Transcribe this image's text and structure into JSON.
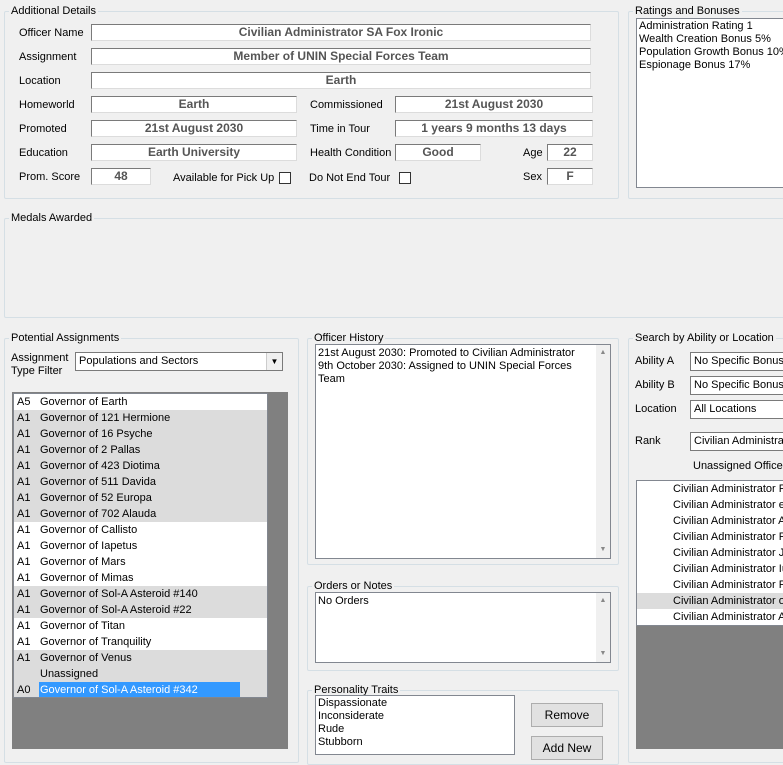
{
  "additional": {
    "legend": "Additional Details",
    "officer_name_label": "Officer Name",
    "officer_name": "Civilian Administrator SA Fox Ironic",
    "assignment_label": "Assignment",
    "assignment": "Member of UNIN Special Forces Team",
    "location_label": "Location",
    "location": "Earth",
    "homeworld_label": "Homeworld",
    "homeworld": "Earth",
    "commissioned_label": "Commissioned",
    "commissioned": "21st August 2030",
    "promoted_label": "Promoted",
    "promoted": "21st August 2030",
    "time_in_tour_label": "Time in Tour",
    "time_in_tour": "1 years 9 months 13 days",
    "education_label": "Education",
    "education": "Earth University",
    "health_label": "Health Condition",
    "health": "Good",
    "age_label": "Age",
    "age": "22",
    "prom_score_label": "Prom. Score",
    "prom_score": "48",
    "pickup_label": "Available for Pick Up",
    "not_end_tour_label": "Do Not End Tour",
    "sex_label": "Sex",
    "sex": "F"
  },
  "ratings": {
    "legend": "Ratings and Bonuses",
    "lines": [
      "Administration Rating 1",
      "Wealth Creation Bonus 5%",
      "Population Growth Bonus 10%",
      "Espionage Bonus 17%"
    ]
  },
  "medals": {
    "legend": "Medals Awarded"
  },
  "potential": {
    "legend": "Potential Assignments",
    "filter_label_1": "Assignment",
    "filter_label_2": "Type Filter",
    "filter_value": "Populations and Sectors",
    "items": [
      {
        "code": "A5",
        "name": "Governor of Earth",
        "shade": false
      },
      {
        "code": "A1",
        "name": "Governor of 121 Hermione",
        "shade": true
      },
      {
        "code": "A1",
        "name": "Governor of 16 Psyche",
        "shade": true
      },
      {
        "code": "A1",
        "name": "Governor of 2 Pallas",
        "shade": true
      },
      {
        "code": "A1",
        "name": "Governor of 423 Diotima",
        "shade": true
      },
      {
        "code": "A1",
        "name": "Governor of 511 Davida",
        "shade": true
      },
      {
        "code": "A1",
        "name": "Governor of 52 Europa",
        "shade": true
      },
      {
        "code": "A1",
        "name": "Governor of 702 Alauda",
        "shade": true
      },
      {
        "code": "A1",
        "name": "Governor of Callisto",
        "shade": false
      },
      {
        "code": "A1",
        "name": "Governor of Iapetus",
        "shade": false
      },
      {
        "code": "A1",
        "name": "Governor of Mars",
        "shade": false
      },
      {
        "code": "A1",
        "name": "Governor of Mimas",
        "shade": false
      },
      {
        "code": "A1",
        "name": "Governor of Sol-A Asteroid #140",
        "shade": true
      },
      {
        "code": "A1",
        "name": "Governor of Sol-A Asteroid #22",
        "shade": true
      },
      {
        "code": "A1",
        "name": "Governor of Titan",
        "shade": false
      },
      {
        "code": "A1",
        "name": "Governor of Tranquility",
        "shade": false
      },
      {
        "code": "A1",
        "name": "Governor of Venus",
        "shade": true
      },
      {
        "code": "",
        "name": "Unassigned",
        "shade": true
      },
      {
        "code": "A0",
        "name": "Governor of Sol-A Asteroid #342",
        "shade": true,
        "selected": true
      }
    ]
  },
  "history": {
    "legend": "Officer History",
    "lines": [
      "21st August 2030: Promoted to Civilian Administrator",
      "9th October 2030: Assigned to UNIN Special Forces",
      "Team"
    ]
  },
  "orders": {
    "legend": "Orders or Notes",
    "text": "No Orders"
  },
  "traits": {
    "legend": "Personality Traits",
    "lines": [
      "Dispassionate",
      "Inconsiderate",
      "Rude",
      "Stubborn"
    ],
    "remove_label": "Remove",
    "add_label": "Add New"
  },
  "search": {
    "legend": "Search by Ability or Location",
    "ability_a_label": "Ability A",
    "ability_a": "No Specific Bonus",
    "ability_b_label": "Ability B",
    "ability_b": "No Specific Bonus",
    "location_label": "Location",
    "location": "All Locations",
    "rank_label": "Rank",
    "rank": "Civilian Administrator",
    "unassigned_label": "Unassigned Officers",
    "officers": [
      {
        "name": "Civilian Administrator Fa",
        "shade": false
      },
      {
        "name": "Civilian Administrator ex",
        "shade": false
      },
      {
        "name": "Civilian Administrator A",
        "shade": false
      },
      {
        "name": "Civilian Administrator Po",
        "shade": false
      },
      {
        "name": "Civilian Administrator Jib",
        "shade": false
      },
      {
        "name": "Civilian Administrator Iu",
        "shade": false
      },
      {
        "name": "Civilian Administrator Fo",
        "shade": false
      },
      {
        "name": "Civilian Administrator oc",
        "shade": true
      },
      {
        "name": "Civilian Administrator An",
        "shade": false
      }
    ]
  }
}
